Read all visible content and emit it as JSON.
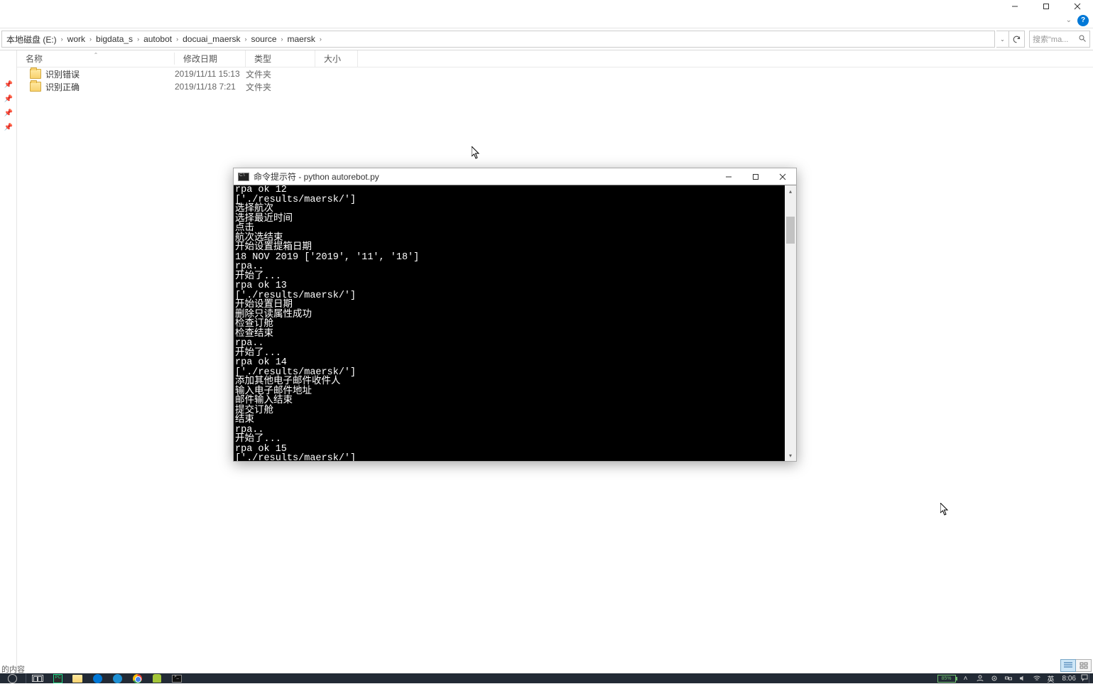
{
  "window": {
    "min_tip": "最小化",
    "max_tip": "最大化",
    "close_tip": "关闭"
  },
  "breadcrumb": {
    "items": [
      "本地磁盘 (E:)",
      "work",
      "bigdata_s",
      "autobot",
      "docuai_maersk",
      "source",
      "maersk"
    ]
  },
  "address": {
    "search_placeholder": "搜索\"ma..."
  },
  "columns": {
    "name": "名称",
    "date": "修改日期",
    "type": "类型",
    "size": "大小"
  },
  "files": [
    {
      "name": "识别错误",
      "date": "2019/11/11 15:13",
      "type": "文件夹",
      "size": ""
    },
    {
      "name": "识别正确",
      "date": "2019/11/18 7:21",
      "type": "文件夹",
      "size": ""
    }
  ],
  "cmd": {
    "title": "命令提示符 - python  autorebot.py",
    "output": "rpa ok 12\n['./results/maersk/']\n选择航次\n选择最近时间\n点击\n航次选结束\n开始设置提箱日期\n18 NOV 2019 ['2019', '11', '18']\nrpa..\n开始了...\nrpa ok 13\n['./results/maersk/']\n开始设置日期\n删除只读属性成功\n检查订舱\n检查结束\nrpa..\n开始了...\nrpa ok 14\n['./results/maersk/']\n添加其他电子邮件收件人\n输入电子邮件地址\n邮件输入结束\n提交订舱\n结束\nrpa..\n开始了...\nrpa ok 15\n['./results/maersk/']"
  },
  "statusbar": {
    "left_label": "的内容"
  },
  "taskbar": {
    "battery": "85%",
    "ime": "英",
    "clock": "8:06"
  }
}
